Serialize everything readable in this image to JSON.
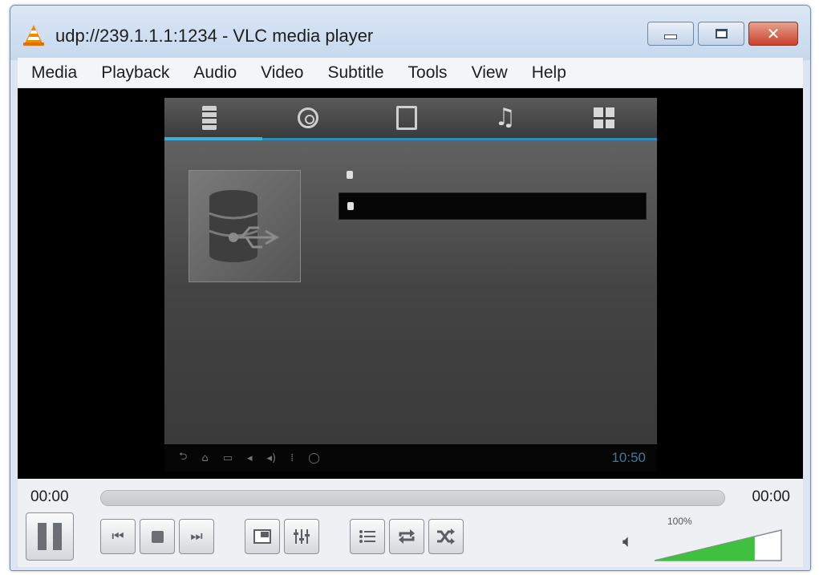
{
  "window": {
    "title": "udp://239.1.1.1:1234 - VLC media player",
    "buttons": {
      "minimize": "minimize",
      "maximize": "maximize",
      "close": "✕"
    }
  },
  "menu": [
    "Media",
    "Playback",
    "Audio",
    "Video",
    "Subtitle",
    "Tools",
    "View",
    "Help"
  ],
  "video": {
    "tabs": [
      {
        "icon": "storage-icon",
        "label": ""
      },
      {
        "icon": "film-reel-icon",
        "label": ""
      },
      {
        "icon": "photo-icon",
        "label": ""
      },
      {
        "icon": "music-note-icon",
        "label": ""
      },
      {
        "icon": "grid-icon",
        "label": ""
      }
    ],
    "list": [
      {
        "icon": "phone-icon",
        "label": ""
      },
      {
        "icon": "network-icon",
        "label": ""
      }
    ],
    "selected_index": 1,
    "path": "",
    "page": "",
    "clock": "10:50"
  },
  "controls": {
    "time_elapsed": "00:00",
    "time_total": "00:00",
    "seek_fraction": 0,
    "volume_label": "100%",
    "volume_fraction": 0.79
  },
  "colors": {
    "accent_blue": "#3ab0df",
    "close_red": "#c8412a",
    "volume_green": "#3fc03f"
  }
}
